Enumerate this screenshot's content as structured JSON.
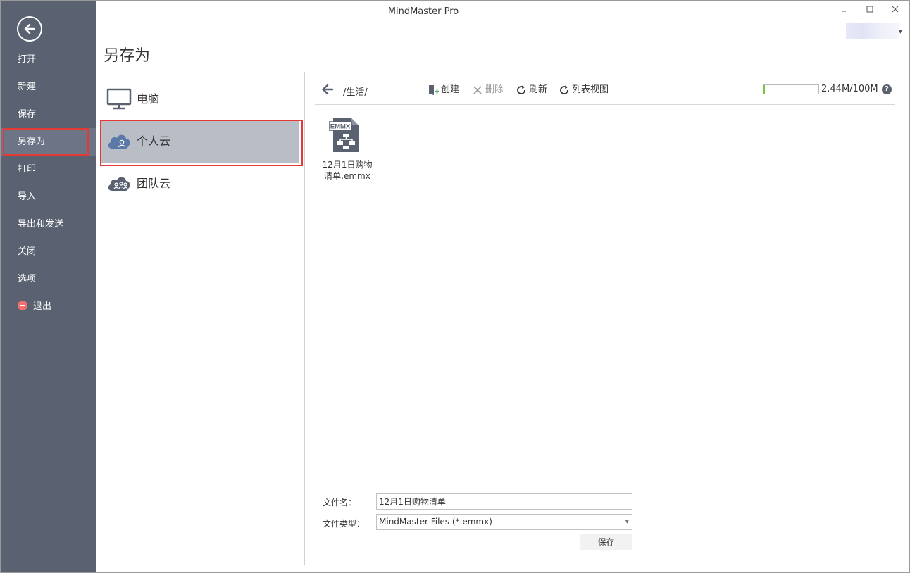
{
  "window": {
    "title": "MindMaster Pro",
    "controls": [
      "minimize",
      "maximize",
      "close"
    ]
  },
  "nav": {
    "items": [
      {
        "label": "打开"
      },
      {
        "label": "新建"
      },
      {
        "label": "保存"
      },
      {
        "label": "另存为",
        "selected": true
      },
      {
        "label": "打印"
      },
      {
        "label": "导入"
      },
      {
        "label": "导出和发送"
      },
      {
        "label": "关闭"
      },
      {
        "label": "选项"
      },
      {
        "label": "退出",
        "icon": "exit-icon"
      }
    ]
  },
  "page": {
    "title": "另存为"
  },
  "locations": [
    {
      "label": "电脑",
      "icon": "monitor-icon"
    },
    {
      "label": "个人云",
      "icon": "personal-cloud-icon",
      "selected": true
    },
    {
      "label": "团队云",
      "icon": "team-cloud-icon"
    }
  ],
  "toolbar": {
    "path": "/生活/",
    "create": "创建",
    "delete": "删除",
    "refresh": "刷新",
    "list_view": "列表视图",
    "storage_text": "2.44M/100M",
    "storage_used_fraction": 0.0244
  },
  "files": [
    {
      "name": "12月1日购物清单.emmx",
      "badge": "EMMX",
      "icon": "emmx-file-icon"
    }
  ],
  "form": {
    "filename_label": "文件名：",
    "filename_value": "12月1日购物清单",
    "filetype_label": "文件类型：",
    "filetype_value": "MindMaster Files (*.emmx)",
    "save_label": "保存"
  },
  "colors": {
    "nav_bg": "#5a6272",
    "selected_location_bg": "#b9bdc6",
    "highlight_border": "#e53935",
    "storage_fill": "#7cc24a"
  }
}
